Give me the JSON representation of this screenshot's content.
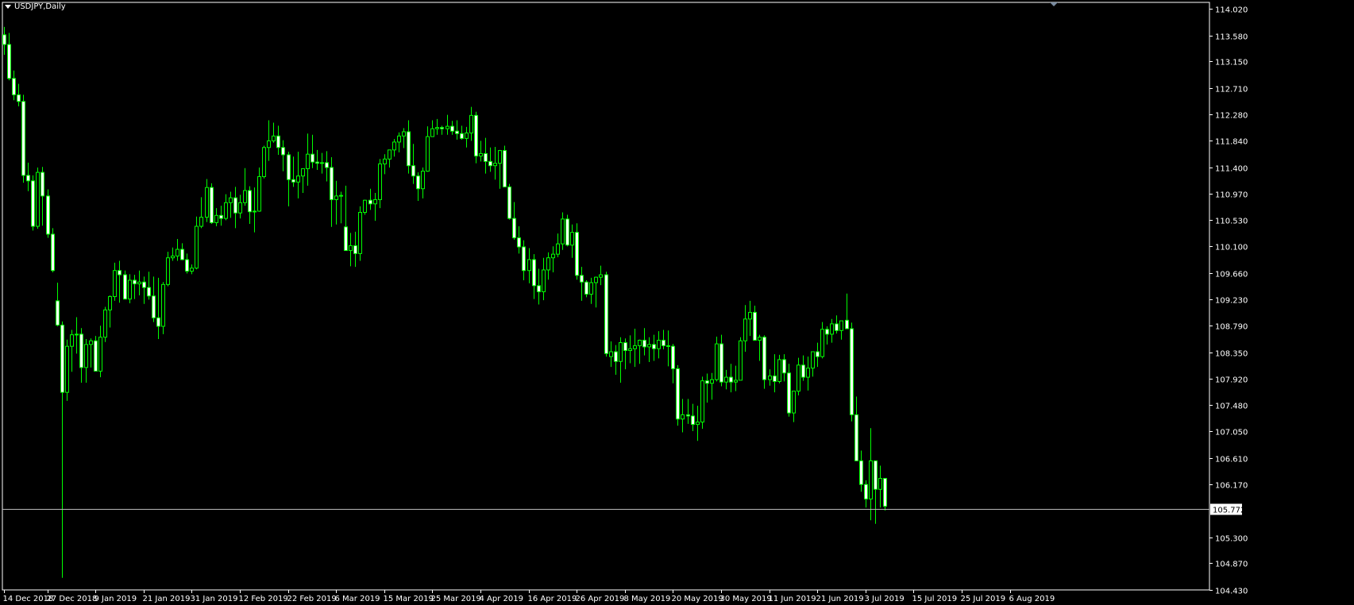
{
  "window": {
    "symbol_label": "USDJPY,Daily",
    "price_label": "105.772"
  },
  "colors": {
    "background": "#000000",
    "axis": "#ffffff",
    "candle": "#00ff00",
    "bull_body": "#000000",
    "bear_body": "#ffffff",
    "bid_line": "#b8b8b8"
  },
  "chart_data": {
    "type": "candlestick",
    "title": "USDJPY,Daily",
    "ylim": [
      104.43,
      114.02
    ],
    "y_ticks": [
      "114.020",
      "113.580",
      "113.150",
      "112.710",
      "112.280",
      "111.840",
      "111.400",
      "110.970",
      "110.530",
      "110.100",
      "109.660",
      "109.230",
      "108.790",
      "108.350",
      "107.920",
      "107.480",
      "107.050",
      "106.610",
      "106.170",
      "105.772",
      "105.300",
      "104.870",
      "104.430"
    ],
    "x_labels": [
      {
        "i": 0,
        "label": "14 Dec 2018"
      },
      {
        "i": 9,
        "label": "27 Dec 2018"
      },
      {
        "i": 19,
        "label": "9 Jan 2019"
      },
      {
        "i": 29,
        "label": "21 Jan 2019"
      },
      {
        "i": 39,
        "label": "31 Jan 2019"
      },
      {
        "i": 49,
        "label": "12 Feb 2019"
      },
      {
        "i": 59,
        "label": "22 Feb 2019"
      },
      {
        "i": 69,
        "label": "6 Mar 2019"
      },
      {
        "i": 79,
        "label": "15 Mar 2019"
      },
      {
        "i": 89,
        "label": "25 Mar 2019"
      },
      {
        "i": 99,
        "label": "4 Apr 2019"
      },
      {
        "i": 109,
        "label": "16 Apr 2019"
      },
      {
        "i": 119,
        "label": "26 Apr 2019"
      },
      {
        "i": 129,
        "label": "8 May 2019"
      },
      {
        "i": 139,
        "label": "20 May 2019"
      },
      {
        "i": 149,
        "label": "30 May 2019"
      },
      {
        "i": 159,
        "label": "11 Jun 2019"
      },
      {
        "i": 169,
        "label": "21 Jun 2019"
      },
      {
        "i": 179,
        "label": "3 Jul 2019"
      },
      {
        "i": 189,
        "label": "15 Jul 2019"
      },
      {
        "i": 199,
        "label": "25 Jul 2019"
      },
      {
        "i": 209,
        "label": "6 Aug 2019"
      }
    ],
    "current_price": 105.772,
    "ohlc": [
      [
        113.59,
        113.72,
        113.26,
        113.43
      ],
      [
        113.43,
        113.62,
        112.84,
        112.87
      ],
      [
        112.87,
        113.0,
        112.51,
        112.6
      ],
      [
        112.6,
        112.78,
        112.41,
        112.49
      ],
      [
        112.49,
        112.6,
        111.15,
        111.27
      ],
      [
        111.27,
        111.48,
        111.01,
        111.18
      ],
      [
        111.18,
        111.27,
        110.36,
        110.43
      ],
      [
        110.43,
        111.4,
        110.39,
        111.32
      ],
      [
        111.32,
        111.41,
        110.44,
        110.93
      ],
      [
        110.93,
        111.04,
        110.24,
        110.3
      ],
      [
        110.3,
        110.4,
        109.67,
        109.7
      ],
      [
        109.2,
        109.5,
        108.78,
        108.8
      ],
      [
        108.8,
        108.86,
        104.63,
        107.69
      ],
      [
        107.69,
        108.56,
        107.55,
        108.45
      ],
      [
        108.45,
        108.72,
        108.03,
        108.64
      ],
      [
        108.64,
        108.93,
        108.33,
        108.65
      ],
      [
        108.65,
        108.75,
        107.85,
        108.1
      ],
      [
        108.1,
        108.57,
        107.85,
        108.48
      ],
      [
        108.48,
        108.58,
        108.1,
        108.54
      ],
      [
        108.54,
        108.62,
        108.06,
        108.04
      ],
      [
        108.04,
        108.79,
        107.94,
        108.6
      ],
      [
        108.6,
        109.1,
        108.52,
        109.05
      ],
      [
        109.05,
        109.29,
        108.76,
        109.27
      ],
      [
        109.27,
        109.83,
        109.2,
        109.7
      ],
      [
        109.7,
        109.86,
        109.17,
        109.63
      ],
      [
        109.63,
        109.7,
        109.22,
        109.23
      ],
      [
        109.23,
        109.64,
        109.16,
        109.54
      ],
      [
        109.54,
        109.63,
        109.23,
        109.48
      ],
      [
        109.48,
        109.7,
        109.29,
        109.51
      ],
      [
        109.51,
        109.6,
        109.15,
        109.42
      ],
      [
        109.42,
        109.68,
        109.22,
        109.28
      ],
      [
        109.28,
        109.6,
        108.85,
        108.92
      ],
      [
        108.92,
        109.58,
        108.57,
        108.78
      ],
      [
        108.78,
        109.51,
        108.65,
        109.47
      ],
      [
        109.47,
        110.01,
        109.44,
        109.91
      ],
      [
        109.91,
        110.08,
        109.86,
        109.94
      ],
      [
        109.94,
        110.22,
        109.86,
        110.05
      ],
      [
        110.05,
        110.15,
        109.87,
        109.88
      ],
      [
        109.88,
        109.98,
        109.65,
        109.69
      ],
      [
        109.69,
        109.8,
        109.64,
        109.74
      ],
      [
        109.74,
        110.59,
        109.72,
        110.43
      ],
      [
        110.43,
        110.91,
        110.4,
        110.58
      ],
      [
        110.58,
        111.21,
        110.5,
        111.07
      ],
      [
        111.07,
        111.14,
        110.47,
        110.49
      ],
      [
        110.49,
        110.73,
        110.43,
        110.61
      ],
      [
        110.61,
        110.77,
        110.44,
        110.56
      ],
      [
        110.56,
        110.96,
        110.53,
        110.82
      ],
      [
        110.82,
        111.0,
        110.57,
        110.9
      ],
      [
        110.9,
        111.08,
        110.4,
        110.65
      ],
      [
        110.65,
        110.95,
        110.56,
        110.82
      ],
      [
        110.82,
        111.39,
        110.77,
        111.02
      ],
      [
        111.02,
        111.09,
        110.47,
        110.67
      ],
      [
        110.67,
        111.07,
        110.33,
        110.68
      ],
      [
        110.68,
        111.4,
        110.67,
        111.25
      ],
      [
        111.25,
        111.76,
        111.22,
        111.73
      ],
      [
        111.73,
        112.18,
        111.51,
        111.84
      ],
      [
        111.84,
        112.14,
        111.81,
        111.92
      ],
      [
        111.92,
        112.09,
        111.61,
        111.73
      ],
      [
        111.73,
        111.85,
        111.34,
        111.61
      ],
      [
        111.61,
        111.66,
        110.76,
        111.2
      ],
      [
        111.2,
        111.58,
        111.08,
        111.16
      ],
      [
        111.16,
        111.66,
        110.89,
        111.26
      ],
      [
        111.26,
        111.38,
        110.98,
        111.38
      ],
      [
        111.38,
        111.96,
        111.1,
        111.62
      ],
      [
        111.62,
        111.94,
        111.39,
        111.49
      ],
      [
        111.49,
        111.69,
        111.36,
        111.47
      ],
      [
        111.47,
        111.64,
        111.3,
        111.48
      ],
      [
        111.48,
        111.67,
        111.17,
        111.4
      ],
      [
        111.4,
        111.57,
        110.42,
        110.87
      ],
      [
        110.87,
        111.18,
        110.46,
        110.93
      ],
      [
        110.93,
        111.0,
        110.48,
        110.94
      ],
      [
        110.42,
        111.1,
        110.09,
        110.03
      ],
      [
        110.03,
        110.32,
        109.77,
        110.11
      ],
      [
        110.11,
        110.34,
        109.76,
        109.98
      ],
      [
        109.98,
        110.76,
        109.86,
        110.66
      ],
      [
        110.66,
        110.87,
        110.62,
        110.86
      ],
      [
        110.86,
        111.05,
        110.7,
        110.8
      ],
      [
        110.8,
        110.98,
        110.52,
        110.87
      ],
      [
        110.87,
        111.54,
        110.73,
        111.46
      ],
      [
        111.46,
        111.62,
        111.29,
        111.54
      ],
      [
        111.54,
        111.62,
        111.4,
        111.69
      ],
      [
        111.69,
        111.87,
        111.58,
        111.82
      ],
      [
        111.82,
        111.98,
        111.65,
        111.92
      ],
      [
        111.92,
        112.05,
        111.72,
        111.99
      ],
      [
        111.99,
        112.18,
        111.3,
        111.43
      ],
      [
        111.43,
        111.79,
        111.13,
        111.26
      ],
      [
        111.26,
        111.32,
        110.85,
        111.05
      ],
      [
        111.05,
        111.4,
        110.89,
        111.34
      ],
      [
        111.34,
        112.08,
        111.33,
        111.91
      ],
      [
        111.91,
        112.18,
        111.93,
        112.04
      ],
      [
        112.04,
        112.2,
        111.94,
        112.06
      ],
      [
        112.06,
        112.09,
        111.94,
        112.04
      ],
      [
        112.04,
        112.27,
        111.94,
        112.08
      ],
      [
        112.08,
        112.17,
        111.94,
        112.0
      ],
      [
        112.0,
        112.18,
        111.86,
        111.96
      ],
      [
        111.96,
        112.09,
        111.86,
        111.88
      ],
      [
        111.88,
        112.07,
        111.73,
        111.97
      ],
      [
        111.97,
        112.4,
        111.84,
        112.26
      ],
      [
        112.26,
        112.32,
        111.47,
        111.59
      ],
      [
        111.59,
        111.84,
        111.5,
        111.63
      ],
      [
        111.63,
        111.89,
        111.3,
        111.5
      ],
      [
        111.5,
        111.73,
        111.33,
        111.43
      ],
      [
        111.43,
        111.74,
        111.2,
        111.47
      ],
      [
        111.47,
        111.69,
        111.05,
        111.68
      ],
      [
        111.68,
        111.76,
        111.11,
        111.08
      ],
      [
        111.08,
        111.13,
        110.54,
        110.56
      ],
      [
        110.56,
        110.83,
        110.21,
        110.24
      ],
      [
        110.24,
        110.43,
        109.98,
        110.09
      ],
      [
        110.09,
        110.2,
        109.54,
        109.7
      ],
      [
        109.7,
        110.07,
        109.49,
        109.88
      ],
      [
        109.88,
        109.97,
        109.23,
        109.45
      ],
      [
        109.45,
        109.73,
        109.14,
        109.35
      ],
      [
        109.35,
        109.91,
        109.21,
        109.71
      ],
      [
        109.71,
        110.0,
        109.55,
        109.91
      ],
      [
        109.91,
        110.1,
        109.67,
        109.97
      ],
      [
        109.97,
        110.31,
        109.92,
        110.14
      ],
      [
        110.14,
        110.66,
        110.04,
        110.55
      ],
      [
        110.55,
        110.62,
        110.1,
        110.12
      ],
      [
        110.12,
        110.46,
        109.91,
        110.33
      ],
      [
        110.33,
        110.48,
        109.55,
        109.62
      ],
      [
        109.62,
        109.76,
        109.2,
        109.51
      ],
      [
        109.51,
        109.54,
        109.26,
        109.31
      ],
      [
        109.31,
        109.58,
        109.15,
        109.5
      ],
      [
        109.5,
        109.6,
        109.09,
        109.59
      ],
      [
        109.59,
        109.78,
        109.46,
        109.63
      ],
      [
        109.63,
        109.68,
        108.28,
        108.33
      ],
      [
        108.28,
        108.53,
        108.11,
        108.36
      ],
      [
        108.36,
        108.47,
        107.98,
        108.2
      ],
      [
        108.2,
        108.6,
        107.85,
        108.51
      ],
      [
        108.51,
        108.58,
        108.07,
        108.38
      ],
      [
        108.38,
        108.63,
        108.17,
        108.41
      ],
      [
        108.41,
        108.74,
        108.11,
        108.46
      ],
      [
        108.46,
        108.56,
        108.16,
        108.55
      ],
      [
        108.55,
        108.75,
        108.3,
        108.44
      ],
      [
        108.44,
        108.6,
        108.19,
        108.48
      ],
      [
        108.48,
        108.64,
        108.21,
        108.41
      ],
      [
        108.41,
        108.7,
        108.25,
        108.55
      ],
      [
        108.55,
        108.72,
        108.4,
        108.46
      ],
      [
        108.46,
        108.71,
        108.12,
        108.45
      ],
      [
        108.45,
        108.49,
        107.84,
        108.08
      ],
      [
        108.08,
        108.14,
        107.14,
        107.25
      ],
      [
        107.25,
        107.58,
        107.03,
        107.32
      ],
      [
        107.32,
        107.58,
        107.17,
        107.3
      ],
      [
        107.3,
        107.5,
        107.05,
        107.16
      ],
      [
        107.16,
        107.47,
        106.89,
        107.2
      ],
      [
        107.2,
        107.95,
        107.09,
        107.88
      ],
      [
        107.88,
        108.0,
        107.52,
        107.84
      ],
      [
        107.84,
        108.01,
        107.57,
        107.9
      ],
      [
        107.9,
        108.61,
        107.87,
        108.49
      ],
      [
        108.49,
        108.64,
        107.79,
        107.86
      ],
      [
        107.86,
        108.06,
        107.74,
        107.94
      ],
      [
        107.94,
        108.16,
        107.69,
        107.86
      ],
      [
        107.86,
        108.13,
        107.71,
        107.89
      ],
      [
        107.89,
        108.6,
        107.89,
        108.54
      ],
      [
        108.54,
        109.13,
        108.36,
        108.9
      ],
      [
        108.9,
        109.2,
        108.62,
        109.01
      ],
      [
        109.01,
        109.12,
        108.54,
        108.55
      ],
      [
        108.55,
        108.64,
        108.21,
        108.6
      ],
      [
        108.6,
        108.63,
        107.75,
        107.9
      ],
      [
        107.9,
        108.07,
        107.8,
        107.96
      ],
      [
        107.96,
        108.32,
        107.69,
        107.87
      ],
      [
        107.87,
        108.31,
        107.84,
        108.23
      ],
      [
        108.23,
        108.32,
        107.87,
        108.01
      ],
      [
        108.01,
        108.16,
        107.29,
        107.35
      ],
      [
        107.35,
        107.62,
        107.2,
        107.71
      ],
      [
        107.71,
        108.26,
        107.64,
        108.14
      ],
      [
        108.14,
        108.3,
        107.88,
        107.94
      ],
      [
        107.94,
        108.28,
        107.72,
        108.09
      ],
      [
        108.09,
        108.35,
        107.95,
        108.36
      ],
      [
        108.36,
        108.51,
        108.11,
        108.28
      ],
      [
        108.28,
        108.85,
        108.25,
        108.73
      ],
      [
        108.73,
        108.78,
        108.48,
        108.65
      ],
      [
        108.65,
        108.9,
        108.51,
        108.82
      ],
      [
        108.82,
        108.96,
        108.66,
        108.71
      ],
      [
        108.71,
        108.86,
        108.56,
        108.87
      ],
      [
        108.88,
        109.32,
        108.75,
        108.74
      ],
      [
        108.74,
        108.84,
        107.21,
        107.32
      ],
      [
        107.32,
        107.62,
        106.7,
        106.56
      ],
      [
        106.56,
        106.73,
        106.05,
        106.17
      ],
      [
        106.17,
        106.24,
        105.79,
        105.93
      ],
      [
        105.93,
        107.1,
        105.58,
        106.56
      ],
      [
        106.56,
        106.4,
        105.52,
        106.09
      ],
      [
        106.09,
        106.48,
        105.79,
        106.27
      ],
      [
        106.27,
        106.08,
        105.74,
        105.81
      ]
    ]
  }
}
